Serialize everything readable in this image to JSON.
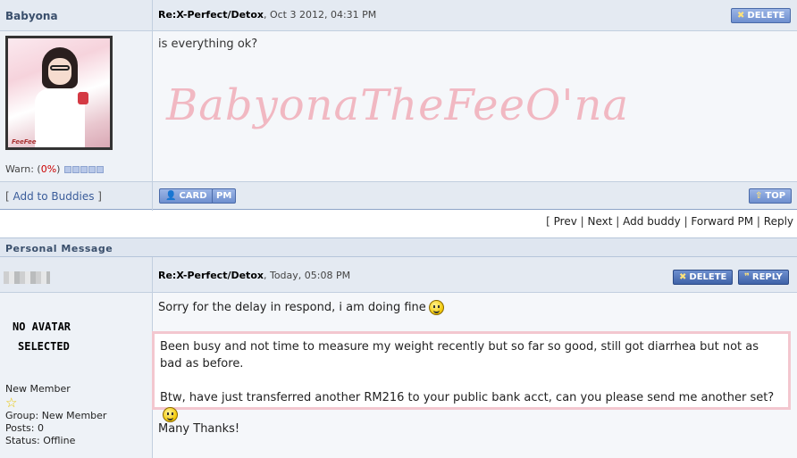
{
  "post1": {
    "author": "Babyona",
    "title_bold": "Re:X-Perfect/Detox",
    "title_date": ", Oct 3 2012, 04:31 PM",
    "delete_label": "DELETE",
    "message": "is everything ok?",
    "signature": "BabyonaTheFeeO'na",
    "avatar_tag": "FeeFee",
    "warn_label": "Warn: (",
    "warn_pct": "0%",
    "warn_close": ")",
    "add_buddy_open": "[ ",
    "add_buddy_label": "Add to Buddies",
    "add_buddy_close": " ]",
    "card_label": "CARD",
    "pm_label": "PM",
    "top_label": "TOP"
  },
  "nav": {
    "open": "[ ",
    "items": [
      "Prev",
      "Next",
      "Add buddy",
      "Forward PM",
      "Reply"
    ],
    "sep": " | "
  },
  "pm_section": {
    "title": "Personal Message"
  },
  "post2": {
    "title_bold": "Re:X-Perfect/Detox",
    "title_date": ", Today, 05:08 PM",
    "delete_label": "DELETE",
    "reply_label": "REPLY",
    "no_avatar_line1": "NO AVATAR",
    "no_avatar_line2": "SELECTED",
    "member_rank": "New Member",
    "group": "Group: New Member",
    "posts": "Posts: 0",
    "status": "Status: Offline",
    "line1": "Sorry for the delay in respond, i am doing fine",
    "quote_p1": "Been busy and not time to measure my weight recently but so far so good, still got diarrhea but not as bad as before.",
    "quote_p2": "Btw, have just transferred another RM216 to your public bank acct, can you please send me another set?",
    "thanks": "Many Thanks!"
  },
  "icons": {
    "delete": "x-icon",
    "card": "user-card-icon",
    "top": "arrow-up-icon",
    "reply": "quote-icon",
    "smiley": "smiley-icon",
    "star": "star-icon"
  },
  "colors": {
    "header_bg": "#e4eaf2",
    "button_blue": "#6e8fcf",
    "quote_border": "#f3c7cf",
    "signature_pink": "#f1b8c2"
  }
}
